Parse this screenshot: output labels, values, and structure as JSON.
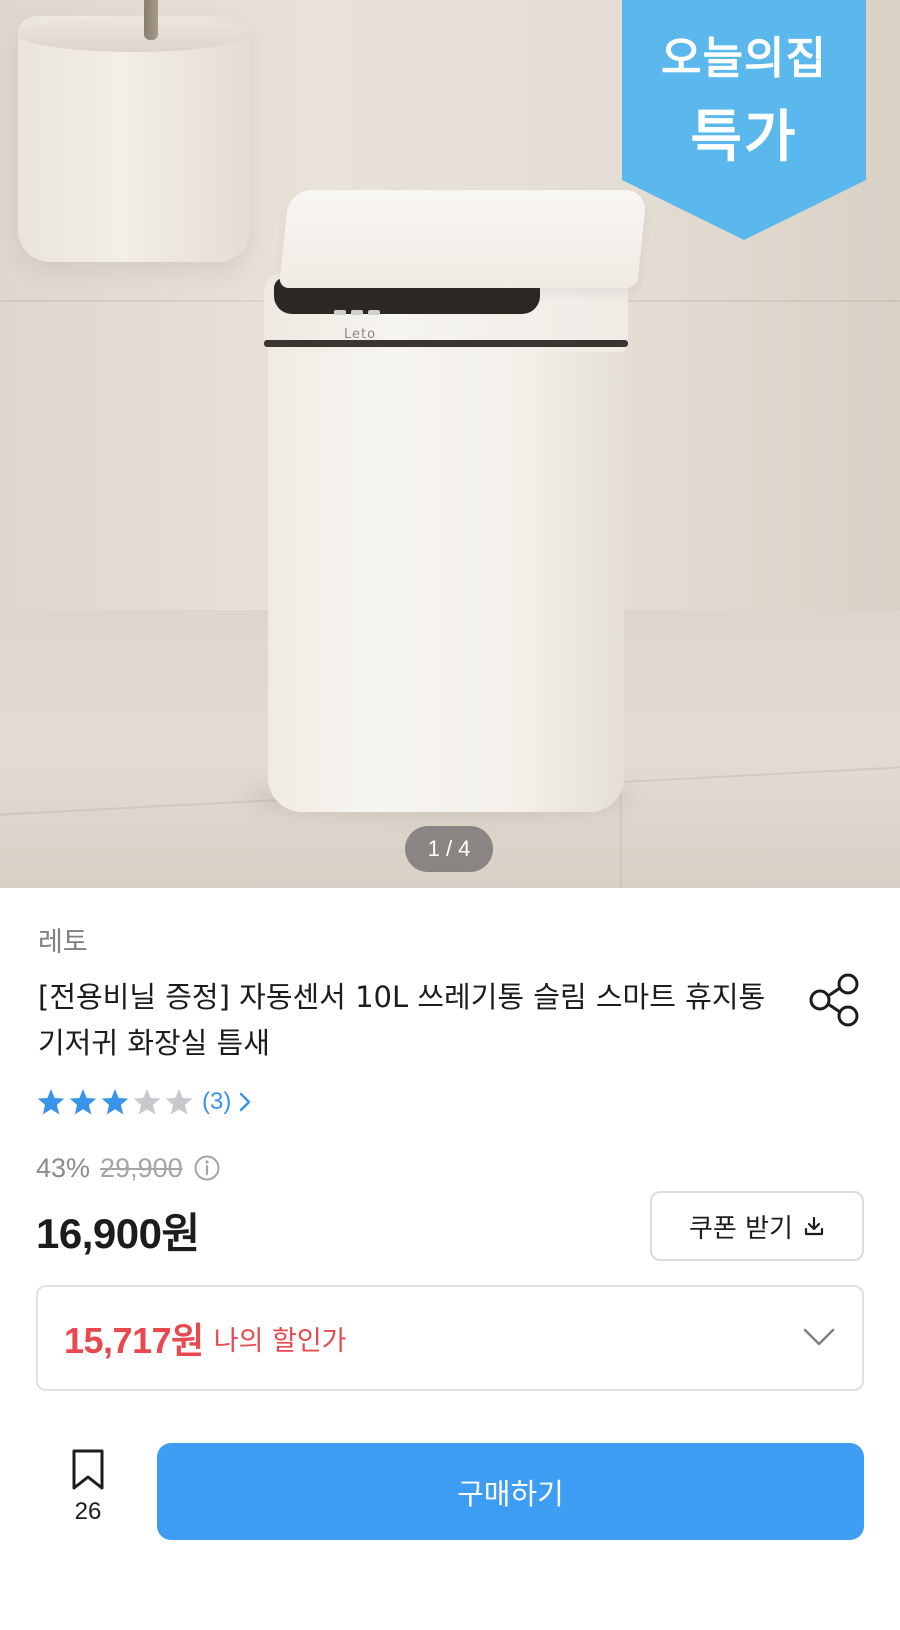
{
  "gallery": {
    "ribbon_line1": "오늘의집",
    "ribbon_line2": "특가",
    "product_logo": "Leto",
    "pager": "1 / 4",
    "ribbon_color": "#5ab8ec"
  },
  "product": {
    "brand": "레토",
    "title": "[전용비닐 증정] 자동센서 10L 쓰레기통 슬림 스마트 휴지통 기저귀 화장실 틈새",
    "rating": {
      "stars": 3,
      "max": 5,
      "count_label": "(3)"
    },
    "discount_percent": "43%",
    "original_price": "29,900",
    "price": "16,900원",
    "coupon_label": "쿠폰 받기",
    "my_price": "15,717원",
    "my_price_label": "나의 할인가"
  },
  "bottom_bar": {
    "bookmark_count": "26",
    "buy_label": "구매하기"
  },
  "colors": {
    "accent_blue": "#3d9df3",
    "star_active": "#3a93ea",
    "star_inactive": "#c7c7cc",
    "sale_red": "#e8494f"
  },
  "icons": [
    "share-icon",
    "star-icon",
    "chevron-right-icon",
    "info-icon",
    "download-icon",
    "chevron-down-icon",
    "bookmark-icon"
  ]
}
